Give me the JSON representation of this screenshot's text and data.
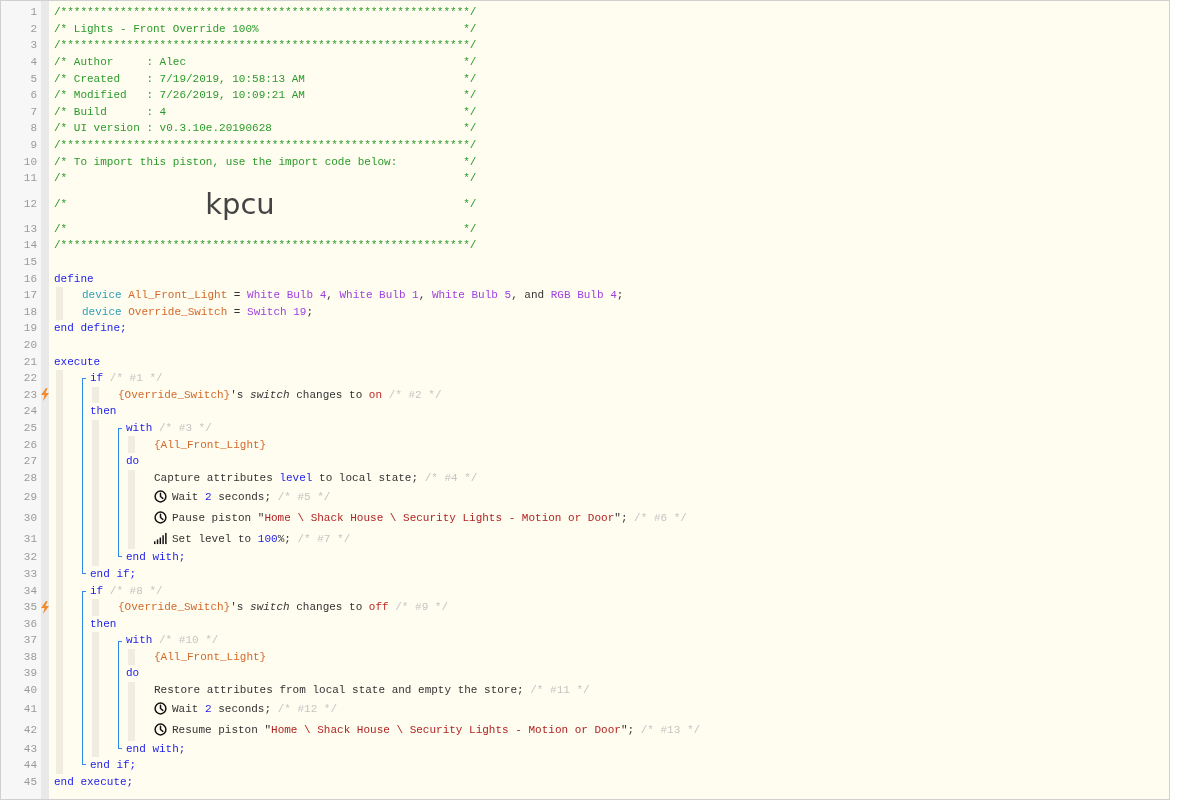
{
  "lines": [
    {
      "n": "1",
      "kind": "code",
      "tokens": [
        {
          "t": "/**************************************************************/",
          "kind": "c"
        }
      ]
    },
    {
      "n": "2",
      "kind": "box",
      "text": "/* Lights - Front Override 100%",
      "close": "*/"
    },
    {
      "n": "3",
      "kind": "code",
      "tokens": [
        {
          "t": "/**************************************************************/",
          "kind": "c"
        }
      ]
    },
    {
      "n": "4",
      "kind": "box",
      "text": "/* Author     : Alec",
      "close": "*/"
    },
    {
      "n": "5",
      "kind": "box",
      "text": "/* Created    : 7/19/2019, 10:58:13 AM",
      "close": "*/"
    },
    {
      "n": "6",
      "kind": "box",
      "text": "/* Modified   : 7/26/2019, 10:09:21 AM",
      "close": "*/"
    },
    {
      "n": "7",
      "kind": "box",
      "text": "/* Build      : 4",
      "close": "*/"
    },
    {
      "n": "8",
      "kind": "box",
      "text": "/* UI version : v0.3.10e.20190628",
      "close": "*/"
    },
    {
      "n": "9",
      "kind": "code",
      "tokens": [
        {
          "t": "/**************************************************************/",
          "kind": "c"
        }
      ]
    },
    {
      "n": "10",
      "kind": "box",
      "text": "/* To import this piston, use the import code below:",
      "close": "*/"
    },
    {
      "n": "11",
      "kind": "box",
      "text": "/*",
      "close": "*/"
    },
    {
      "n": "12",
      "kind": "banner",
      "text": "/*",
      "code": "kpcu",
      "close": "*/"
    },
    {
      "n": "13",
      "kind": "box",
      "text": "/*",
      "close": "*/"
    },
    {
      "n": "14",
      "kind": "code",
      "tokens": [
        {
          "t": "/**************************************************************/",
          "kind": "c"
        }
      ]
    },
    {
      "n": "15",
      "kind": "code"
    },
    {
      "n": "16",
      "kind": "code",
      "tokens": [
        {
          "t": "define",
          "kind": "kw"
        }
      ],
      "children": [
        {
          "n": "17",
          "kind": "code",
          "tokens": [
            {
              "t": "device ",
              "kind": "dk"
            },
            {
              "t": "All_Front_Light",
              "kind": "var"
            },
            {
              "t": " = ",
              "kind": "p"
            },
            {
              "t": "White Bulb 4",
              "kind": "dev"
            },
            {
              "t": ", ",
              "kind": "p"
            },
            {
              "t": "White Bulb 1",
              "kind": "dev"
            },
            {
              "t": ", ",
              "kind": "p"
            },
            {
              "t": "White Bulb 5",
              "kind": "dev"
            },
            {
              "t": ", and ",
              "kind": "p"
            },
            {
              "t": "RGB Bulb 4",
              "kind": "dev"
            },
            {
              "t": ";",
              "kind": "p"
            }
          ]
        },
        {
          "n": "18",
          "kind": "code",
          "tokens": [
            {
              "t": "device ",
              "kind": "dk"
            },
            {
              "t": "Override_Switch",
              "kind": "var"
            },
            {
              "t": " = ",
              "kind": "p"
            },
            {
              "t": "Switch 19",
              "kind": "dev"
            },
            {
              "t": ";",
              "kind": "p"
            }
          ]
        }
      ]
    },
    {
      "n": "19",
      "kind": "code",
      "tokens": [
        {
          "t": "end define;",
          "kind": "kw"
        }
      ]
    },
    {
      "n": "20",
      "kind": "code"
    },
    {
      "n": "21",
      "kind": "code",
      "tokens": [
        {
          "t": "execute",
          "kind": "kw"
        }
      ],
      "children": [
        {
          "kind": "block",
          "children": [
            {
              "n": "22",
              "kind": "code",
              "tokens": [
                {
                  "t": "if ",
                  "kind": "kw"
                },
                {
                  "t": "/* #1 */",
                  "kind": "rem"
                }
              ],
              "children": [
                {
                  "n": "23",
                  "kind": "trigger",
                  "tokens": [
                    {
                      "t": "{Override_Switch}",
                      "kind": "var"
                    },
                    {
                      "t": "'s ",
                      "kind": "p"
                    },
                    {
                      "t": "switch",
                      "kind": "em"
                    },
                    {
                      "t": " changes to ",
                      "kind": "p"
                    },
                    {
                      "t": "on ",
                      "kind": "val"
                    },
                    {
                      "t": "/* #2 */",
                      "kind": "rem"
                    }
                  ]
                }
              ]
            },
            {
              "n": "24",
              "kind": "code",
              "tokens": [
                {
                  "t": "then",
                  "kind": "kw"
                }
              ],
              "children": [
                {
                  "kind": "block",
                  "children": [
                    {
                      "n": "25",
                      "kind": "code",
                      "tokens": [
                        {
                          "t": "with ",
                          "kind": "kw"
                        },
                        {
                          "t": "/* #3 */",
                          "kind": "rem"
                        }
                      ],
                      "children": [
                        {
                          "n": "26",
                          "kind": "code",
                          "tokens": [
                            {
                              "t": "{All_Front_Light}",
                              "kind": "var"
                            }
                          ]
                        }
                      ]
                    },
                    {
                      "n": "27",
                      "kind": "code",
                      "tokens": [
                        {
                          "t": "do",
                          "kind": "kw"
                        }
                      ],
                      "children": [
                        {
                          "n": "28",
                          "kind": "code",
                          "tokens": [
                            {
                              "t": "Capture attributes ",
                              "kind": "p"
                            },
                            {
                              "t": "level",
                              "kind": "kw"
                            },
                            {
                              "t": " to local state; ",
                              "kind": "p"
                            },
                            {
                              "t": "/* #4 */",
                              "kind": "rem"
                            }
                          ]
                        },
                        {
                          "n": "29",
                          "kind": "timer",
                          "tokens": [
                            {
                              "t": "Wait ",
                              "kind": "p"
                            },
                            {
                              "t": "2",
                              "kind": "num"
                            },
                            {
                              "t": " seconds; ",
                              "kind": "p"
                            },
                            {
                              "t": "/* #5 */",
                              "kind": "rem"
                            }
                          ]
                        },
                        {
                          "n": "30",
                          "kind": "timer",
                          "tokens": [
                            {
                              "t": "Pause piston \"",
                              "kind": "p"
                            },
                            {
                              "t": "Home \\ Shack House \\ Security Lights - Motion or Door",
                              "kind": "str"
                            },
                            {
                              "t": "\"; ",
                              "kind": "p"
                            },
                            {
                              "t": "/* #6 */",
                              "kind": "rem"
                            }
                          ]
                        },
                        {
                          "n": "31",
                          "kind": "dimmer",
                          "tokens": [
                            {
                              "t": "Set level to ",
                              "kind": "p"
                            },
                            {
                              "t": "100",
                              "kind": "num"
                            },
                            {
                              "t": "%; ",
                              "kind": "p"
                            },
                            {
                              "t": "/* #7 */",
                              "kind": "rem"
                            }
                          ]
                        }
                      ]
                    },
                    {
                      "n": "32",
                      "kind": "code",
                      "tokens": [
                        {
                          "t": "end with;",
                          "kind": "kw"
                        }
                      ]
                    }
                  ]
                }
              ]
            },
            {
              "n": "33",
              "kind": "code",
              "tokens": [
                {
                  "t": "end if;",
                  "kind": "kw"
                }
              ]
            }
          ]
        },
        {
          "kind": "block",
          "children": [
            {
              "n": "34",
              "kind": "code",
              "tokens": [
                {
                  "t": "if ",
                  "kind": "kw"
                },
                {
                  "t": "/* #8 */",
                  "kind": "rem"
                }
              ],
              "children": [
                {
                  "n": "35",
                  "kind": "trigger",
                  "tokens": [
                    {
                      "t": "{Override_Switch}",
                      "kind": "var"
                    },
                    {
                      "t": "'s ",
                      "kind": "p"
                    },
                    {
                      "t": "switch",
                      "kind": "em"
                    },
                    {
                      "t": " changes to ",
                      "kind": "p"
                    },
                    {
                      "t": "off ",
                      "kind": "val"
                    },
                    {
                      "t": "/* #9 */",
                      "kind": "rem"
                    }
                  ]
                }
              ]
            },
            {
              "n": "36",
              "kind": "code",
              "tokens": [
                {
                  "t": "then",
                  "kind": "kw"
                }
              ],
              "children": [
                {
                  "kind": "block",
                  "children": [
                    {
                      "n": "37",
                      "kind": "code",
                      "tokens": [
                        {
                          "t": "with ",
                          "kind": "kw"
                        },
                        {
                          "t": "/* #10 */",
                          "kind": "rem"
                        }
                      ],
                      "children": [
                        {
                          "n": "38",
                          "kind": "code",
                          "tokens": [
                            {
                              "t": "{All_Front_Light}",
                              "kind": "var"
                            }
                          ]
                        }
                      ]
                    },
                    {
                      "n": "39",
                      "kind": "code",
                      "tokens": [
                        {
                          "t": "do",
                          "kind": "kw"
                        }
                      ],
                      "children": [
                        {
                          "n": "40",
                          "kind": "code",
                          "tokens": [
                            {
                              "t": "Restore attributes from local state and empty the store; ",
                              "kind": "p"
                            },
                            {
                              "t": "/* #11 */",
                              "kind": "rem"
                            }
                          ]
                        },
                        {
                          "n": "41",
                          "kind": "timer",
                          "tokens": [
                            {
                              "t": "Wait ",
                              "kind": "p"
                            },
                            {
                              "t": "2",
                              "kind": "num"
                            },
                            {
                              "t": " seconds; ",
                              "kind": "p"
                            },
                            {
                              "t": "/* #12 */",
                              "kind": "rem"
                            }
                          ]
                        },
                        {
                          "n": "42",
                          "kind": "timer",
                          "tokens": [
                            {
                              "t": "Resume piston \"",
                              "kind": "p"
                            },
                            {
                              "t": "Home \\ Shack House \\ Security Lights - Motion or Door",
                              "kind": "str"
                            },
                            {
                              "t": "\"; ",
                              "kind": "p"
                            },
                            {
                              "t": "/* #13 */",
                              "kind": "rem"
                            }
                          ]
                        }
                      ]
                    },
                    {
                      "n": "43",
                      "kind": "code",
                      "tokens": [
                        {
                          "t": "end with;",
                          "kind": "kw"
                        }
                      ]
                    }
                  ]
                }
              ]
            },
            {
              "n": "44",
              "kind": "code",
              "tokens": [
                {
                  "t": "end if;",
                  "kind": "kw"
                }
              ]
            }
          ]
        }
      ]
    },
    {
      "n": "45",
      "kind": "code",
      "tokens": [
        {
          "t": "end execute;",
          "kind": "kw"
        }
      ]
    }
  ]
}
